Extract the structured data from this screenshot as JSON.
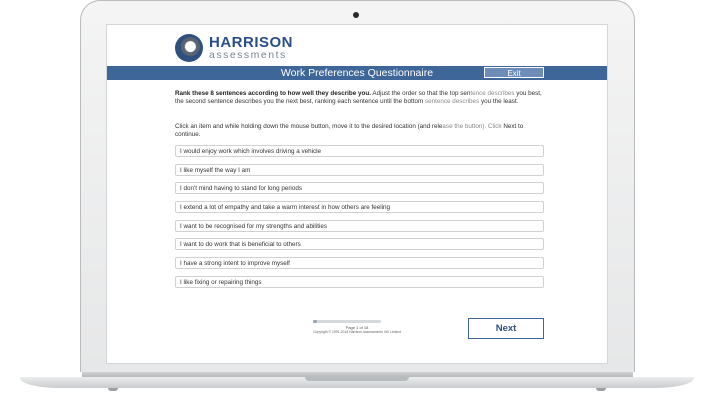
{
  "app": {
    "logo_main": "HARRISON",
    "logo_sub": "assessments"
  },
  "header": {
    "title": "Work Preferences Questionnaire",
    "exit_label": "Exit"
  },
  "instructions": {
    "bold": "Rank these 8 sentences according to how well they describe you.",
    "line1_rest": " Adjust the order so that the top sen",
    "line1_fade": "tence describes",
    "line2": "you best, the second sentence describes you the next best, ranking each sentence until the bottom ",
    "line2_fade": "sentence describes",
    "line3": "you the least.",
    "drag_text": "Click an item and while holding down the mouse button, move it to the desired location (and rele",
    "drag_fade": "ase the button). Click",
    "drag_text2": "Next to continue."
  },
  "items": [
    "I would enjoy work which involves driving a vehicle",
    "I like myself the way I am",
    "I don't mind having to stand for long periods",
    "I extend a lot of empathy and take a warm interest in how others are feeling",
    "I want to be recognised for my strengths and abilities",
    "I want to do work that is beneficial to others",
    "I have a strong intent to improve myself",
    "I like fixing or repairing things"
  ],
  "footer": {
    "page": "Page 1 of 18",
    "copyright": "Copyright © 1991-2018 Harrison Assessments Int'l Limited",
    "progress_fraction": 0.06,
    "next_label": "Next"
  },
  "colors": {
    "brand_blue": "#3f6699",
    "logo_blue": "#2a4f86"
  }
}
